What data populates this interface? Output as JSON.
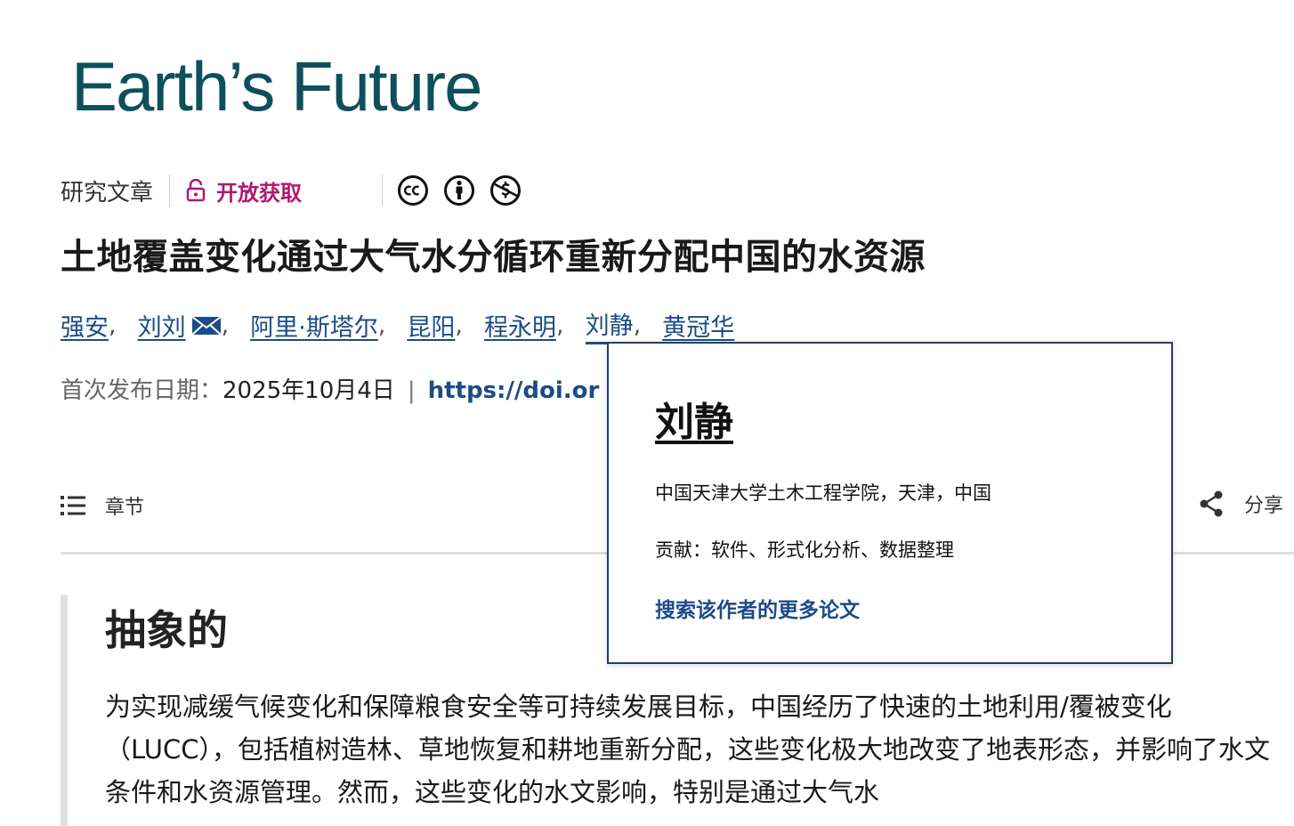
{
  "journal": {
    "logo_text": "Earth’s Future"
  },
  "article": {
    "type_label": "研究文章",
    "access_label": "开放获取",
    "license_icons": [
      "cc-icon",
      "by-attribution-icon",
      "noncommercial-icon"
    ],
    "title": "土地覆盖变化通过大气水分循环重新分配中国的水资源",
    "authors": [
      {
        "name": "强安",
        "separator": ","
      },
      {
        "name": "刘刘",
        "separator": ",",
        "has_email": true
      },
      {
        "name": "阿里·斯塔尔",
        "separator": ","
      },
      {
        "name": "昆阳",
        "separator": ","
      },
      {
        "name": "程永明",
        "separator": ","
      },
      {
        "name": "刘静",
        "separator": ","
      },
      {
        "name": "黄冠华",
        "separator": ""
      }
    ],
    "pubdate_label": "首次发布日期：",
    "pubdate_value": "2025年10月4日",
    "pubdate_separator": "|",
    "doi_text": "https://doi.or"
  },
  "toolbar": {
    "sections_label": "章节",
    "share_label": "分享"
  },
  "abstract": {
    "heading": "抽象的",
    "text": "为实现减缓气候变化和保障粮食安全等可持续发展目标，中国经历了快速的土地利用/覆被变化（LUCC），包括植树造林、草地恢复和耕地重新分配，这些变化极大地改变了地表形态，并影响了水文条件和水资源管理。然而，这些变化的水文影响，特别是通过大气水"
  },
  "author_popup": {
    "name": "刘静",
    "affiliation": "中国天津大学土木工程学院，天津，中国",
    "contribution": "贡献：软件、形式化分析、数据整理",
    "search_link": "搜索该作者的更多论文"
  },
  "colors": {
    "logo": "#0e4f5c",
    "open_access": "#b2186f",
    "link": "#1c4c87",
    "popup_border": "#1c3f73"
  }
}
